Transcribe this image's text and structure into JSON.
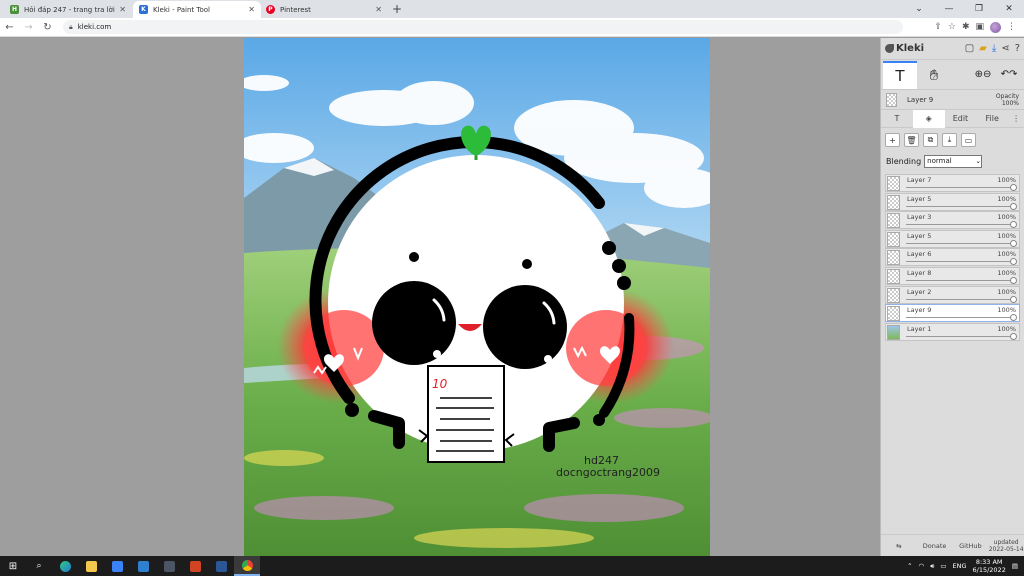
{
  "browser": {
    "tabs": [
      {
        "title": "Hỏi đáp 247 - trang tra lời",
        "favicon_color": "#4a8f3c",
        "favicon_letter": "H",
        "active": false
      },
      {
        "title": "Kleki - Paint Tool",
        "favicon_color": "#2c6fd6",
        "favicon_letter": "K",
        "active": true
      },
      {
        "title": "Pinterest",
        "favicon_color": "#e60023",
        "favicon_letter": "P",
        "active": false
      }
    ],
    "new_tab_label": "+",
    "url": "kleki.com"
  },
  "kleki": {
    "logo": "Kleki",
    "current_layer": {
      "name": "Layer 9",
      "opacity_label": "Opacity",
      "opacity_value": "100%"
    },
    "panel_tabs": [
      "Edit",
      "File"
    ],
    "blending_label": "Blending",
    "blending_value": "normal",
    "layers": [
      {
        "name": "Layer 7",
        "opacity": "100%",
        "active": false
      },
      {
        "name": "Layer 5",
        "opacity": "100%",
        "active": false
      },
      {
        "name": "Layer 3",
        "opacity": "100%",
        "active": false
      },
      {
        "name": "Layer 5",
        "opacity": "100%",
        "active": false
      },
      {
        "name": "Layer 6",
        "opacity": "100%",
        "active": false
      },
      {
        "name": "Layer 8",
        "opacity": "100%",
        "active": false
      },
      {
        "name": "Layer 2",
        "opacity": "100%",
        "active": false
      },
      {
        "name": "Layer 9",
        "opacity": "100%",
        "active": true
      },
      {
        "name": "Layer 1",
        "opacity": "100%",
        "active": false
      }
    ],
    "footer": {
      "donate": "Donate",
      "github": "GitHub",
      "updated_label": "updated",
      "updated_date": "2022-05-14"
    }
  },
  "artwork": {
    "paper_score": "10",
    "signature_line1": "hd247",
    "signature_line2": "docngoctrang2009"
  },
  "taskbar": {
    "lang": "ENG",
    "time": "8:33 AM",
    "date": "6/15/2022"
  }
}
